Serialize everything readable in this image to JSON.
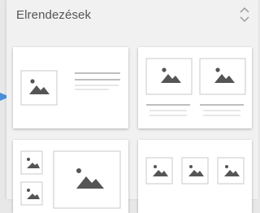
{
  "panel": {
    "title": "Elrendezések",
    "collapse_icon": "chevron-up-down-icon",
    "indicator_icon": "arrow-right-icon",
    "accent_color": "#4a90d9"
  },
  "layouts": [
    {
      "id": "image-left-text-right",
      "selected": true
    },
    {
      "id": "two-images-with-captions",
      "selected": false
    },
    {
      "id": "small-images-left-large-right",
      "selected": false
    },
    {
      "id": "three-images-grid",
      "selected": false
    }
  ]
}
